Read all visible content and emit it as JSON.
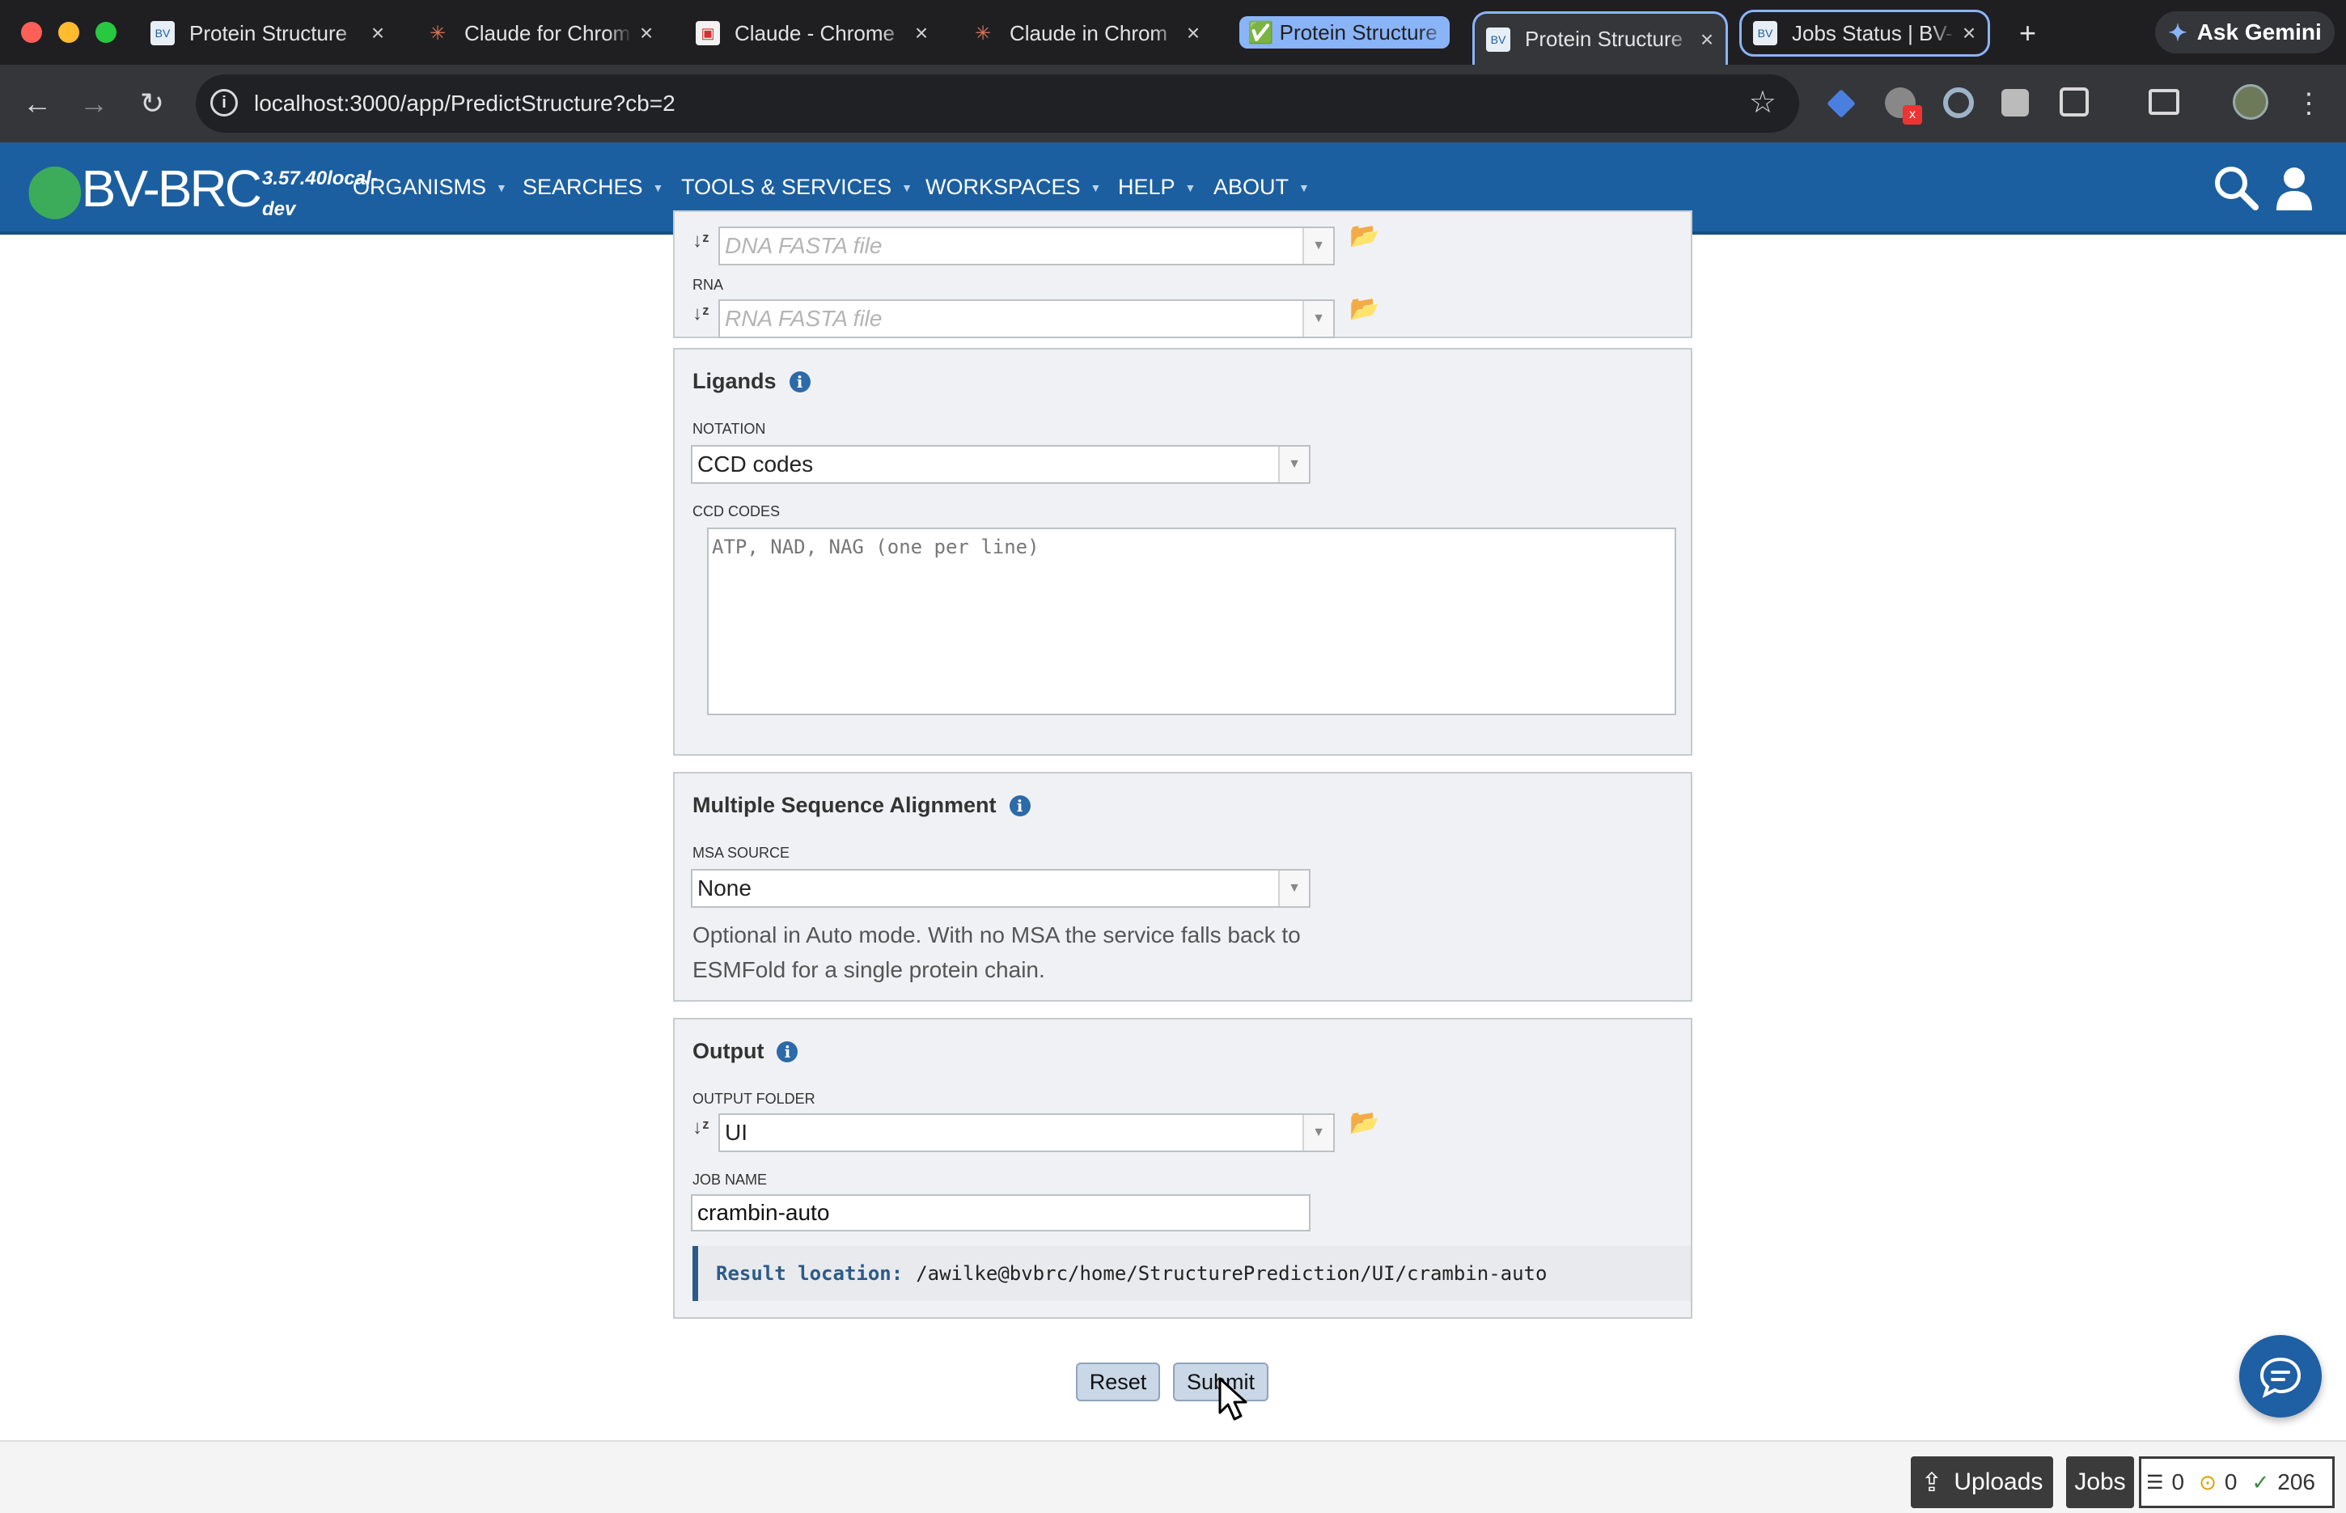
{
  "browser": {
    "tabs": [
      {
        "title": "Protein Structure",
        "favicon": "bvbrc-favicon",
        "close": "×"
      },
      {
        "title": "Claude for Chrom",
        "favicon": "claude-favicon",
        "close": "×"
      },
      {
        "title": "Claude - Chrome",
        "favicon": "image-favicon",
        "close": "×"
      },
      {
        "title": "Claude in Chrom",
        "favicon": "claude-favicon",
        "close": "×"
      },
      {
        "title": "✅ Protein Structure",
        "favicon": "group-chip",
        "close": ""
      },
      {
        "title": "Protein Structure",
        "favicon": "bvbrc-favicon",
        "close": "×"
      },
      {
        "title": "Jobs Status | BV-",
        "favicon": "bvbrc-favicon",
        "close": "×"
      }
    ],
    "new_tab": "+",
    "gemini_label": "Ask Gemini",
    "url": "localhost:3000/app/PredictStructure?cb=2"
  },
  "app": {
    "logo": "BV-BRC",
    "version": "3.57.40local-dev",
    "menu": [
      {
        "label": "ORGANISMS"
      },
      {
        "label": "SEARCHES"
      },
      {
        "label": "TOOLS & SERVICES"
      },
      {
        "label": "WORKSPACES"
      },
      {
        "label": "HELP"
      },
      {
        "label": "ABOUT"
      }
    ]
  },
  "form": {
    "dna": {
      "placeholder": "DNA FASTA file"
    },
    "rna": {
      "label": "RNA",
      "placeholder": "RNA FASTA file"
    },
    "ligands": {
      "title": "Ligands",
      "notation_label": "NOTATION",
      "notation_value": "CCD codes",
      "ccd_label": "CCD CODES",
      "ccd_placeholder": "ATP, NAD, NAG (one per line)"
    },
    "msa": {
      "title": "Multiple Sequence Alignment",
      "source_label": "MSA SOURCE",
      "source_value": "None",
      "help": "Optional in Auto mode. With no MSA the service falls back to ESMFold for a single protein chain."
    },
    "output": {
      "title": "Output",
      "folder_label": "OUTPUT FOLDER",
      "folder_value": "UI",
      "job_label": "JOB NAME",
      "job_value": "crambin-auto",
      "result_label": "Result location:",
      "result_path": "/awilke@bvbrc/home/StructurePrediction/UI/crambin-auto"
    },
    "reset_label": "Reset",
    "submit_label": "Submit"
  },
  "footer": {
    "uploads_label": "Uploads",
    "jobs_label": "Jobs",
    "queued": "0",
    "running": "0",
    "completed": "206"
  },
  "colors": {
    "nav_blue": "#1c5fa0",
    "logo_green": "#3cab5a",
    "panel_bg": "#f0f1f4"
  }
}
